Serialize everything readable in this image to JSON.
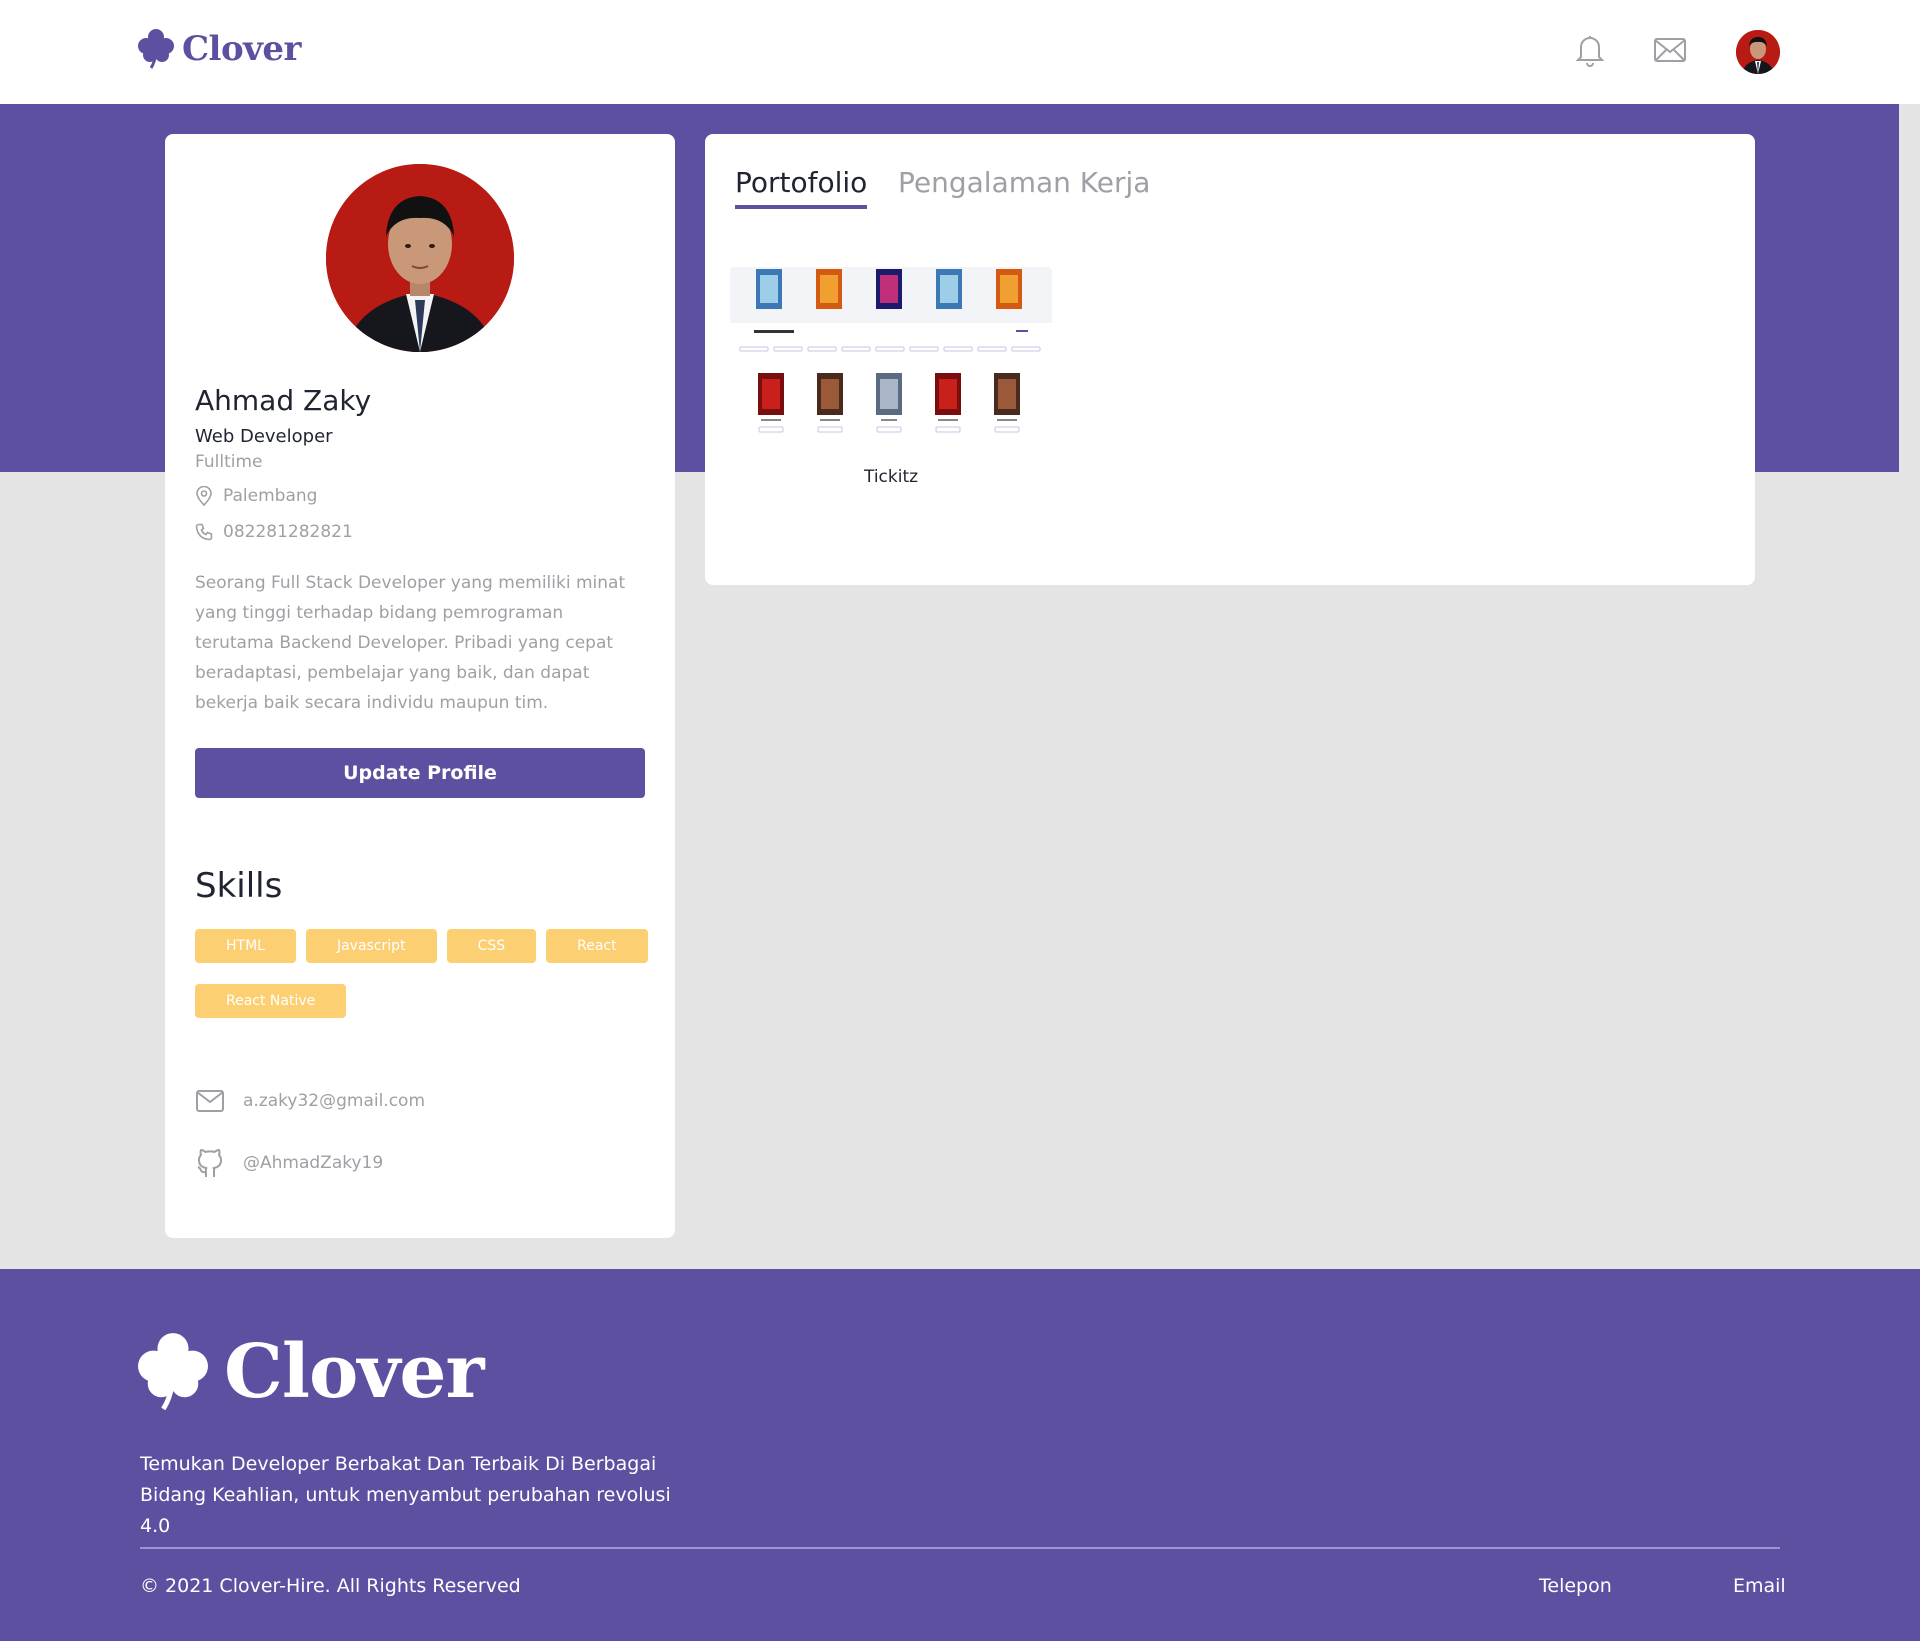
{
  "navbar": {
    "logo_text": "Clover",
    "icons": [
      "bell-icon",
      "mail-icon"
    ]
  },
  "profile": {
    "name": "Ahmad Zaky",
    "job_title": "Web Developer",
    "job_type": "Fulltime",
    "location": "Palembang",
    "phone": "082281282821",
    "bio": "Seorang Full Stack Developer yang memiliki minat yang tinggi terhadap bidang pemrograman terutama Backend Developer. Pribadi yang cepat beradaptasi, pembelajar yang baik, dan dapat bekerja baik secara individu maupun tim.",
    "update_button": "Update Profile",
    "skills_title": "Skills",
    "skills": [
      "HTML",
      "Javascript",
      "CSS",
      "React",
      "React Native"
    ],
    "email": "a.zaky32@gmail.com",
    "github": "@AhmadZaky19"
  },
  "tabs": {
    "portfolio": "Portofolio",
    "experience": "Pengalaman Kerja"
  },
  "portfolio_items": [
    {
      "caption": "Tickitz",
      "thumb_label": "Upcoming Movies"
    }
  ],
  "footer": {
    "logo_text": "Clover",
    "tagline": "Temukan Developer Berbakat Dan Terbaik Di Berbagai Bidang Keahlian, untuk menyambut perubahan revolusi 4.0",
    "copyright": "© 2021 Clover-Hire. All Rights Reserved",
    "link_phone": "Telepon",
    "link_email": "Email"
  },
  "colors": {
    "primary": "#5e50a1",
    "skill": "#fbb017",
    "muted": "#9ea0a5",
    "background": "#e4e4e4"
  }
}
